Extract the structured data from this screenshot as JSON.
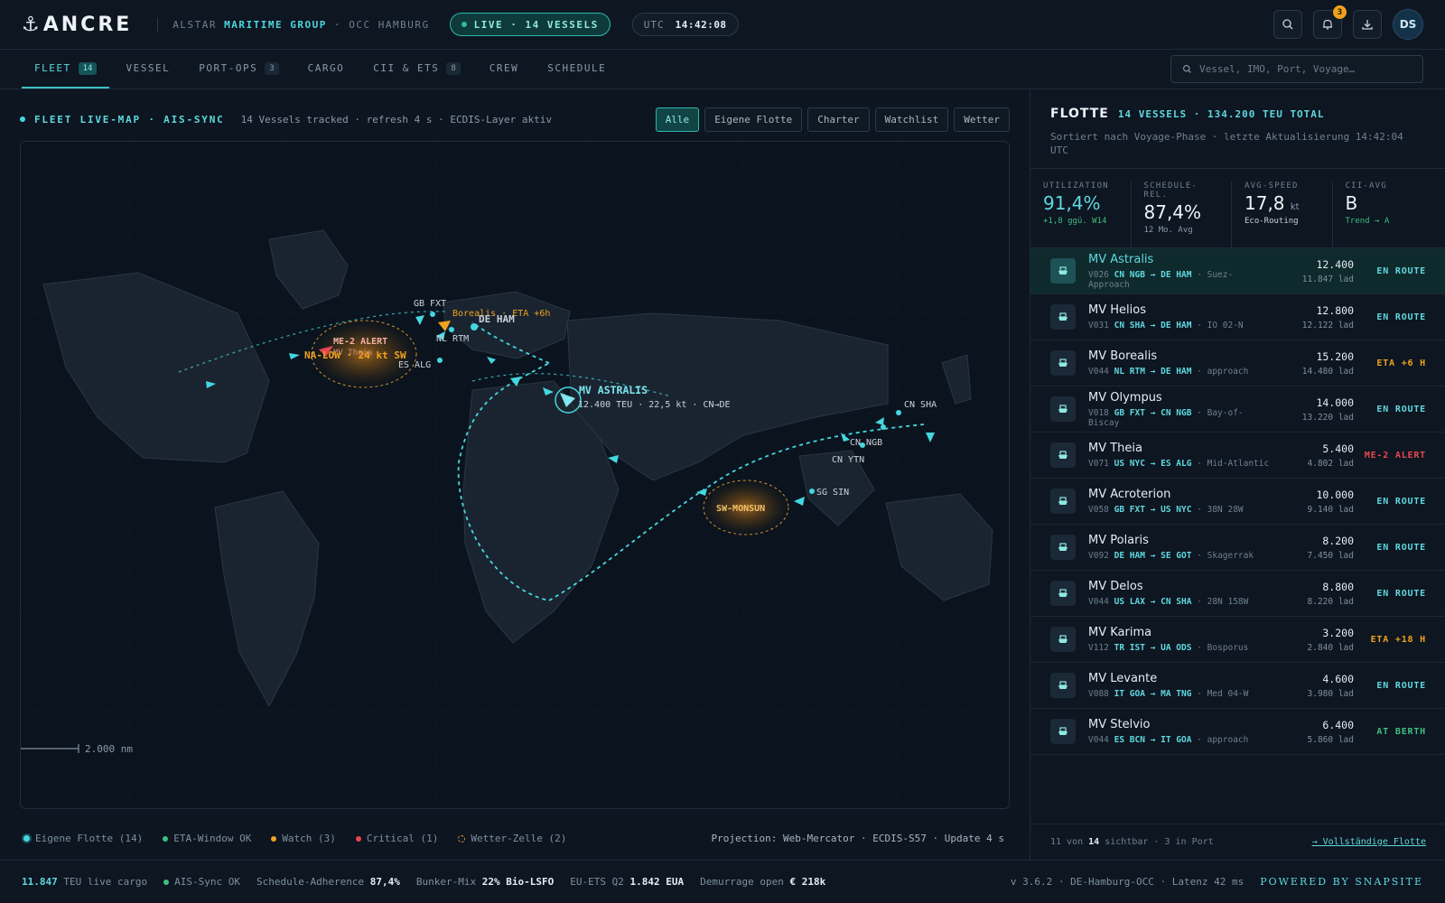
{
  "brand": {
    "logo": "ANCRE",
    "org_prefix": "ALSTAR",
    "org_highlight": "MARITIME GROUP",
    "org_suffix": "· OCC HAMBURG"
  },
  "live": {
    "label": "LIVE · 14 VESSELS"
  },
  "clock": {
    "zone": "UTC",
    "time": "14:42:08"
  },
  "notifications": {
    "count": "3"
  },
  "user": {
    "initials": "DS"
  },
  "nav": {
    "tabs": [
      {
        "label": "FLEET",
        "count": "14"
      },
      {
        "label": "VESSEL",
        "count": ""
      },
      {
        "label": "PORT-OPS",
        "count": "3"
      },
      {
        "label": "CARGO",
        "count": ""
      },
      {
        "label": "CII & ETS",
        "count": "8"
      },
      {
        "label": "CREW",
        "count": ""
      },
      {
        "label": "SCHEDULE",
        "count": ""
      }
    ],
    "search_placeholder": "Vessel, IMO, Port, Voyage…"
  },
  "map": {
    "title": "FLEET LIVE-MAP · AIS-SYNC",
    "subtitle": "14 Vessels tracked · refresh 4 s · ECDIS-Layer aktiv",
    "filters": [
      "Alle",
      "Eigene Flotte",
      "Charter",
      "Watchlist",
      "Wetter"
    ],
    "scale": "2.000 nm",
    "labels": {
      "gb_fxt": "GB FXT",
      "de_ham": "DE HAM",
      "nl_rtm": "NL RTM",
      "es_alg": "ES ALG",
      "cn_sha": "CN SHA",
      "cn_ngb": "CN NGB",
      "cn_ytn": "CN YTN",
      "sg_sin": "SG SIN",
      "borealis_eta": "Borealis · ETA +6h",
      "me2_alert": "ME-2 ALERT",
      "me2_vessel": "MV Theia",
      "na_low": "NA-LOW · 24 kt SW",
      "sw_monsun": "SW-MONSUN",
      "astralis_name": "MV ASTRALIS",
      "astralis_info": "12.400 TEU · 22,5 kt · CN→DE"
    },
    "legend": [
      {
        "label": "Eigene Flotte (14)",
        "color": "#45d7e0"
      },
      {
        "label": "ETA-Window OK",
        "color": "#3fbf7f"
      },
      {
        "label": "Watch (3)",
        "color": "#f0a21e"
      },
      {
        "label": "Critical (1)",
        "color": "#e5484d"
      },
      {
        "label": "Wetter-Zelle (2)",
        "color": "#d4902a"
      }
    ],
    "projection": "Projection: Web-Mercator · ECDIS-S57 · Update 4 s"
  },
  "fleet": {
    "title": "FLOTTE",
    "summary": "14 VESSELS · 134.200 TEU TOTAL",
    "subtitle": "Sortiert nach Voyage-Phase · letzte Aktualisierung 14:42:04 UTC",
    "kpis": [
      {
        "label": "UTILIZATION",
        "value": "91,4%",
        "unit": "",
        "note": "+1,8 ggü. W14",
        "value_color": "#5fd8df",
        "note_color": "#3fbf7f"
      },
      {
        "label": "SCHEDULE-REL.",
        "value": "87,4%",
        "unit": "",
        "note": "12 Mo. Avg",
        "value_color": "#eef3f7",
        "note_color": "#8a9aa9"
      },
      {
        "label": "AVG-SPEED",
        "value": "17,8",
        "unit": "kt",
        "note": "Eco-Routing",
        "value_color": "#eef3f7",
        "note_color": "#c9d3dc"
      },
      {
        "label": "CII-AVG",
        "value": "B",
        "unit": "",
        "note": "Trend → A",
        "value_color": "#eef3f7",
        "note_color": "#3fbf7f"
      }
    ],
    "vessels": [
      {
        "name": "MV Astralis",
        "voy": "V026",
        "route": "CN NGB → DE HAM",
        "pos": "· Suez-Approach",
        "teu": "12.400",
        "lad": "11.847 lad",
        "status": "EN ROUTE",
        "color": "#5fd8df"
      },
      {
        "name": "MV Helios",
        "voy": "V031",
        "route": "CN SHA → DE HAM",
        "pos": "· IO 02-N",
        "teu": "12.800",
        "lad": "12.122 lad",
        "status": "EN ROUTE",
        "color": "#5fd8df"
      },
      {
        "name": "MV Borealis",
        "voy": "V044",
        "route": "NL RTM → DE HAM",
        "pos": "· approach",
        "teu": "15.200",
        "lad": "14.480 lad",
        "status": "ETA +6 H",
        "color": "#f0a21e"
      },
      {
        "name": "MV Olympus",
        "voy": "V018",
        "route": "GB FXT → CN NGB",
        "pos": "· Bay-of-Biscay",
        "teu": "14.000",
        "lad": "13.220 lad",
        "status": "EN ROUTE",
        "color": "#5fd8df"
      },
      {
        "name": "MV Theia",
        "voy": "V071",
        "route": "US NYC → ES ALG",
        "pos": "· Mid-Atlantic",
        "teu": "5.400",
        "lad": "4.802 lad",
        "status": "ME-2 ALERT",
        "color": "#e5484d"
      },
      {
        "name": "MV Acroterion",
        "voy": "V058",
        "route": "GB FXT → US NYC",
        "pos": "· 38N 28W",
        "teu": "10.000",
        "lad": "9.140 lad",
        "status": "EN ROUTE",
        "color": "#5fd8df"
      },
      {
        "name": "MV Polaris",
        "voy": "V092",
        "route": "DE HAM → SE GOT",
        "pos": "· Skagerrak",
        "teu": "8.200",
        "lad": "7.450 lad",
        "status": "EN ROUTE",
        "color": "#5fd8df"
      },
      {
        "name": "MV Delos",
        "voy": "V044",
        "route": "US LAX → CN SHA",
        "pos": "· 28N 158W",
        "teu": "8.800",
        "lad": "8.220 lad",
        "status": "EN ROUTE",
        "color": "#5fd8df"
      },
      {
        "name": "MV Karima",
        "voy": "V112",
        "route": "TR IST → UA ODS",
        "pos": "· Bosporus",
        "teu": "3.200",
        "lad": "2.840 lad",
        "status": "ETA +18 H",
        "color": "#f0a21e"
      },
      {
        "name": "MV Levante",
        "voy": "V088",
        "route": "IT GOA → MA TNG",
        "pos": "· Med 04-W",
        "teu": "4.600",
        "lad": "3.980 lad",
        "status": "EN ROUTE",
        "color": "#5fd8df"
      },
      {
        "name": "MV Stelvio",
        "voy": "V044",
        "route": "ES BCN → IT GOA",
        "pos": "· approach",
        "teu": "6.400",
        "lad": "5.860 lad",
        "status": "AT BERTH",
        "color": "#3fbf7f"
      }
    ],
    "footer_prefix": "11 von",
    "footer_total": "14",
    "footer_suffix": "sichtbar · 3 in Port",
    "footer_link": "→ Vollständige Flotte"
  },
  "status": {
    "teu": "11.847",
    "teu_label": "TEU live cargo",
    "ais": "AIS-Sync OK",
    "adherence_label": "Schedule-Adherence",
    "adherence": "87,4%",
    "bunker_label": "Bunker-Mix",
    "bunker": "22% Bio-LSFO",
    "ets_label": "EU-ETS Q2",
    "ets": "1.842 EUA",
    "demurrage_label": "Demurrage open",
    "demurrage": "€ 218k",
    "version": "v 3.6.2 · DE-Hamburg-OCC · Latenz 42 ms",
    "powered": "POWERED BY SNAPSITE"
  }
}
